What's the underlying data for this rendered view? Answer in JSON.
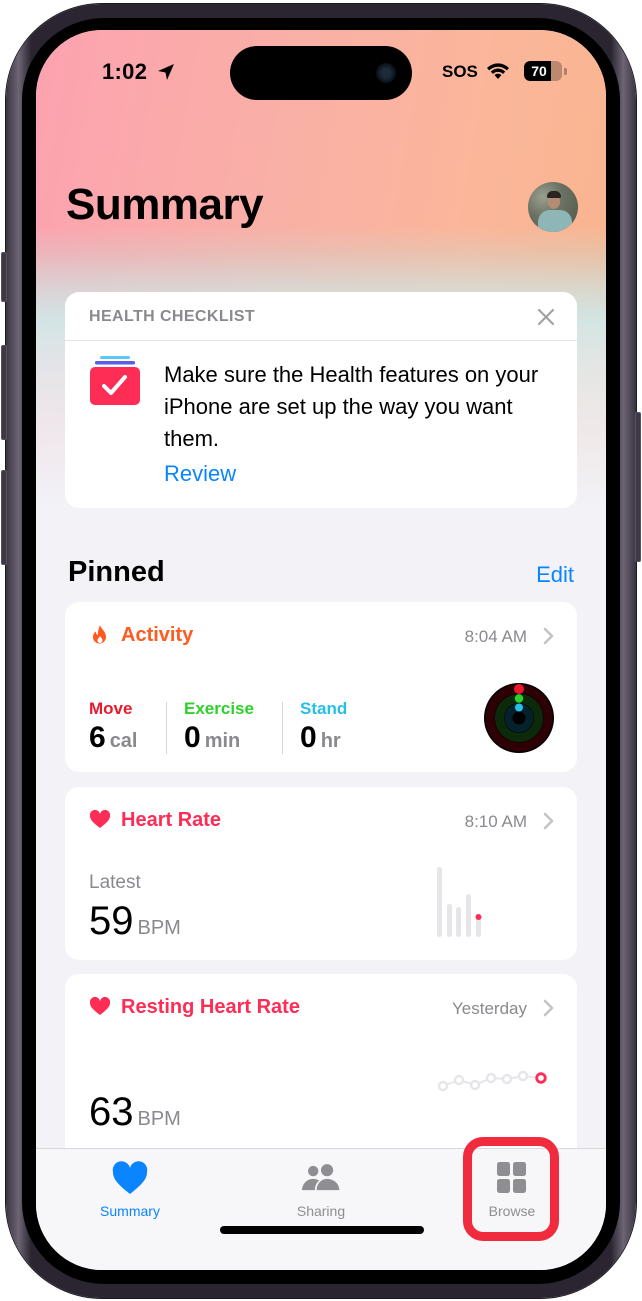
{
  "status_bar": {
    "time": "1:02",
    "carrier": "SOS",
    "battery_percent": 70,
    "battery_label": "70"
  },
  "header": {
    "title": "Summary",
    "avatar_alt": "Profile photo"
  },
  "checklist": {
    "header": "HEALTH CHECKLIST",
    "message": "Make sure the Health features on your iPhone are set up the way you want them.",
    "link": "Review"
  },
  "pinned": {
    "title": "Pinned",
    "edit_label": "Edit"
  },
  "activity": {
    "title": "Activity",
    "time": "8:04 AM",
    "color": "#ff5a1f",
    "metrics": [
      {
        "label": "Move",
        "value": "6",
        "unit": "cal",
        "color": "#e8192c"
      },
      {
        "label": "Exercise",
        "value": "0",
        "unit": "min",
        "color": "#2ed12a"
      },
      {
        "label": "Stand",
        "value": "0",
        "unit": "hr",
        "color": "#26bfe6"
      }
    ]
  },
  "heart_rate": {
    "title": "Heart Rate",
    "time": "8:10 AM",
    "color": "#fe2d55",
    "latest_label": "Latest",
    "value": "59",
    "unit": "BPM"
  },
  "resting_heart_rate": {
    "title": "Resting Heart Rate",
    "time": "Yesterday",
    "color": "#fe2d55",
    "value": "63",
    "unit": "BPM"
  },
  "tab_bar": {
    "active_color": "#0a84ff",
    "inactive_color": "#8e8e93",
    "highlight_color": "#ef2b3d",
    "tabs": [
      {
        "label": "Summary",
        "icon": "heart-icon",
        "active": true
      },
      {
        "label": "Sharing",
        "icon": "people-icon",
        "active": false
      },
      {
        "label": "Browse",
        "icon": "grid-icon",
        "active": false,
        "highlighted": true
      }
    ]
  }
}
